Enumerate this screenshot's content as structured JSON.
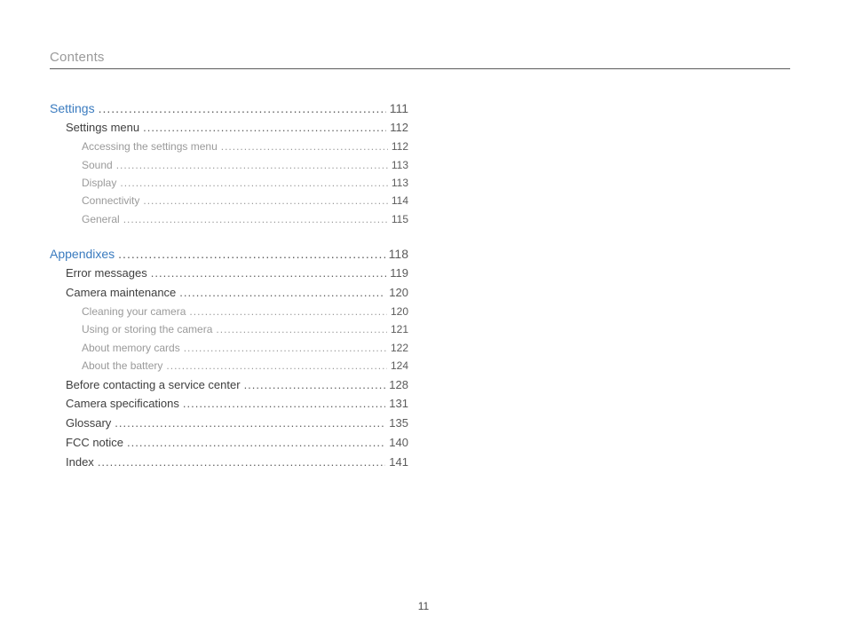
{
  "header": {
    "title": "Contents"
  },
  "pageNumber": "11",
  "toc": {
    "sections": [
      {
        "title": "Settings",
        "page": "111",
        "items": [
          {
            "title": "Settings menu",
            "page": "112",
            "subitems": [
              {
                "title": "Accessing the settings menu",
                "page": "112"
              },
              {
                "title": "Sound",
                "page": "113"
              },
              {
                "title": "Display",
                "page": "113"
              },
              {
                "title": "Connectivity",
                "page": "114"
              },
              {
                "title": "General",
                "page": "115"
              }
            ]
          }
        ]
      },
      {
        "title": "Appendixes",
        "page": "118",
        "items": [
          {
            "title": "Error messages",
            "page": "119",
            "subitems": []
          },
          {
            "title": "Camera maintenance",
            "page": "120",
            "subitems": [
              {
                "title": "Cleaning your camera",
                "page": "120"
              },
              {
                "title": "Using or storing the camera",
                "page": "121"
              },
              {
                "title": "About memory cards",
                "page": "122"
              },
              {
                "title": "About the battery",
                "page": "124"
              }
            ]
          },
          {
            "title": "Before contacting a service center",
            "page": "128",
            "subitems": []
          },
          {
            "title": "Camera specifications",
            "page": "131",
            "subitems": []
          },
          {
            "title": "Glossary",
            "page": "135",
            "subitems": []
          },
          {
            "title": "FCC notice",
            "page": "140",
            "subitems": []
          },
          {
            "title": "Index",
            "page": "141",
            "subitems": []
          }
        ]
      }
    ]
  }
}
